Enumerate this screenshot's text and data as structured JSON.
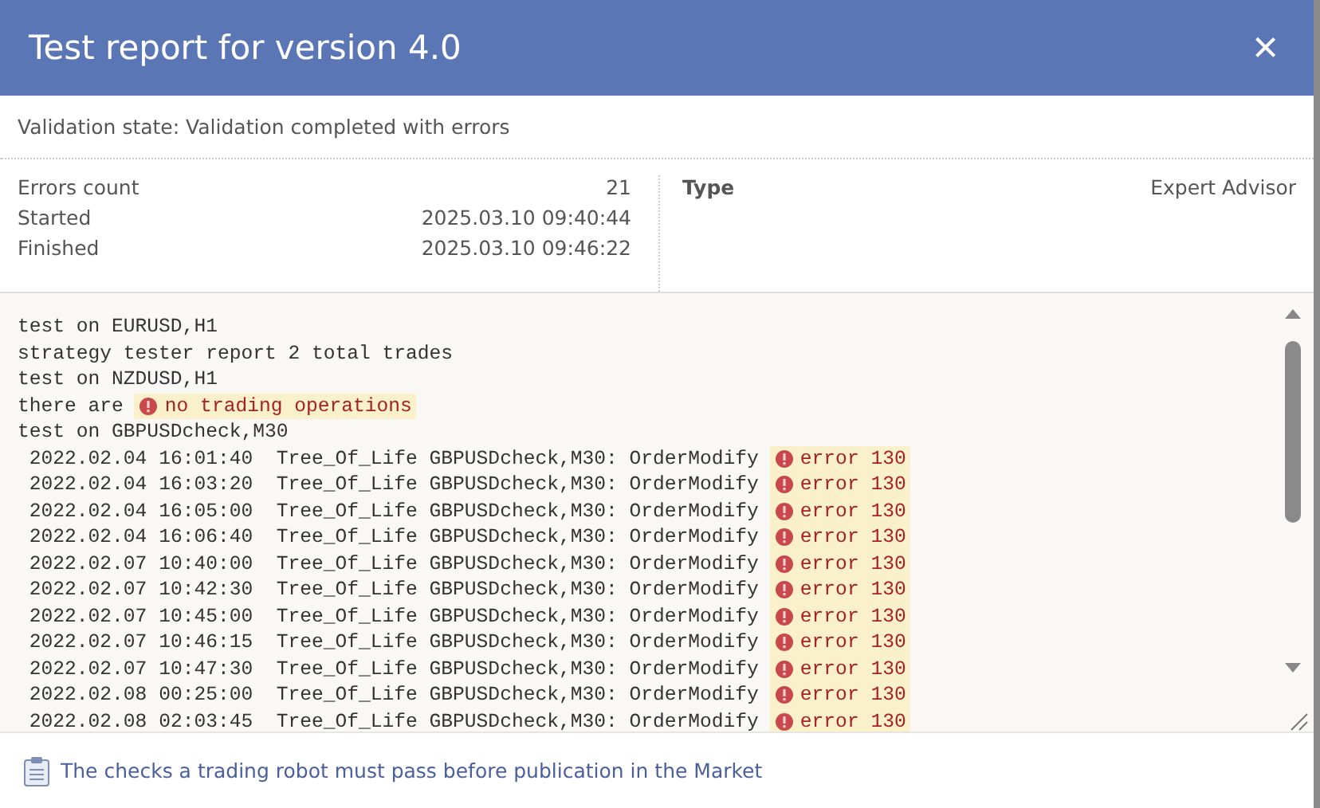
{
  "dialog": {
    "title": "Test report for version 4.0",
    "close": "×"
  },
  "validation": "Validation state: Validation completed with errors",
  "info_left": [
    {
      "label": "Errors count",
      "value": "21"
    },
    {
      "label": "Started",
      "value": "2025.03.10 09:40:44"
    },
    {
      "label": "Finished",
      "value": "2025.03.10 09:46:22"
    }
  ],
  "info_right": [
    {
      "label": "Type",
      "value": "Expert Advisor"
    }
  ],
  "log": [
    {
      "kind": "plain",
      "text": "test on EURUSD,H1"
    },
    {
      "kind": "plain",
      "text": "strategy tester report 2 total trades"
    },
    {
      "kind": "plain",
      "text": "test on NZDUSD,H1"
    },
    {
      "kind": "error",
      "text": "there are",
      "error": "no trading operations"
    },
    {
      "kind": "plain",
      "text": "test on GBPUSDcheck,M30"
    },
    {
      "kind": "entry",
      "text": "2022.02.04 16:01:40  Tree_Of_Life GBPUSDcheck,M30: OrderModify",
      "error": "error 130"
    },
    {
      "kind": "entry",
      "text": "2022.02.04 16:03:20  Tree_Of_Life GBPUSDcheck,M30: OrderModify",
      "error": "error 130"
    },
    {
      "kind": "entry",
      "text": "2022.02.04 16:05:00  Tree_Of_Life GBPUSDcheck,M30: OrderModify",
      "error": "error 130"
    },
    {
      "kind": "entry",
      "text": "2022.02.04 16:06:40  Tree_Of_Life GBPUSDcheck,M30: OrderModify",
      "error": "error 130"
    },
    {
      "kind": "entry",
      "text": "2022.02.07 10:40:00  Tree_Of_Life GBPUSDcheck,M30: OrderModify",
      "error": "error 130"
    },
    {
      "kind": "entry",
      "text": "2022.02.07 10:42:30  Tree_Of_Life GBPUSDcheck,M30: OrderModify",
      "error": "error 130"
    },
    {
      "kind": "entry",
      "text": "2022.02.07 10:45:00  Tree_Of_Life GBPUSDcheck,M30: OrderModify",
      "error": "error 130"
    },
    {
      "kind": "entry",
      "text": "2022.02.07 10:46:15  Tree_Of_Life GBPUSDcheck,M30: OrderModify",
      "error": "error 130"
    },
    {
      "kind": "entry",
      "text": "2022.02.07 10:47:30  Tree_Of_Life GBPUSDcheck,M30: OrderModify",
      "error": "error 130"
    },
    {
      "kind": "entry",
      "text": "2022.02.08 00:25:00  Tree_Of_Life GBPUSDcheck,M30: OrderModify",
      "error": "error 130"
    },
    {
      "kind": "entry",
      "text": "2022.02.08 02:03:45  Tree_Of_Life GBPUSDcheck,M30: OrderModify",
      "error": "error 130"
    }
  ],
  "footer_link": "The checks a trading robot must pass before publication in the Market"
}
